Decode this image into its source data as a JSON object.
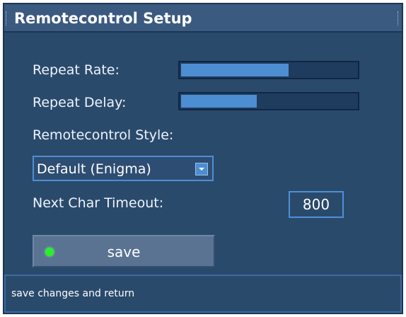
{
  "window": {
    "title": "Remotecontrol Setup"
  },
  "repeat_rate": {
    "label": "Repeat Rate:",
    "fraction": 0.62
  },
  "repeat_delay": {
    "label": "Repeat Delay:",
    "fraction": 0.44
  },
  "style": {
    "label": "Remotecontrol Style:",
    "selected": "Default (Enigma)"
  },
  "next_char_timeout": {
    "label": "Next Char Timeout:",
    "value": "800"
  },
  "save_button": {
    "label": "save",
    "indicator_color": "#28f02a"
  },
  "status_bar": {
    "text": "save changes and return"
  },
  "colors": {
    "background": "#2a4a6c",
    "title_bar": "#3b5a80",
    "slider_fill": "#4d8ed2",
    "focus_border": "#4e8fd6"
  }
}
